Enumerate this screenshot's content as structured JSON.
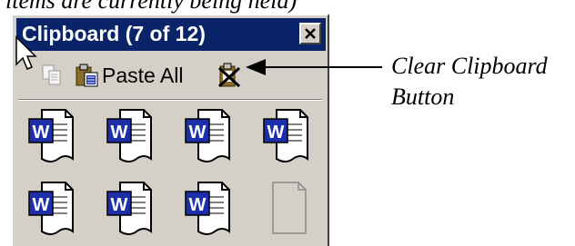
{
  "top_caption": "items are currently being held)",
  "window": {
    "title": "Clipboard (7 of 12)"
  },
  "toolbar": {
    "paste_all_label": "Paste All"
  },
  "items": [
    {
      "type": "word-doc"
    },
    {
      "type": "word-doc"
    },
    {
      "type": "word-doc"
    },
    {
      "type": "word-doc"
    },
    {
      "type": "word-doc"
    },
    {
      "type": "word-doc"
    },
    {
      "type": "word-doc"
    },
    {
      "type": "empty"
    }
  ],
  "annotation": {
    "line1": "Clear Clipboard",
    "line2": "Button"
  },
  "colors": {
    "titlebar": "#0a246a",
    "panel": "#d4d0c8",
    "word_blue": "#1c2ea8"
  }
}
